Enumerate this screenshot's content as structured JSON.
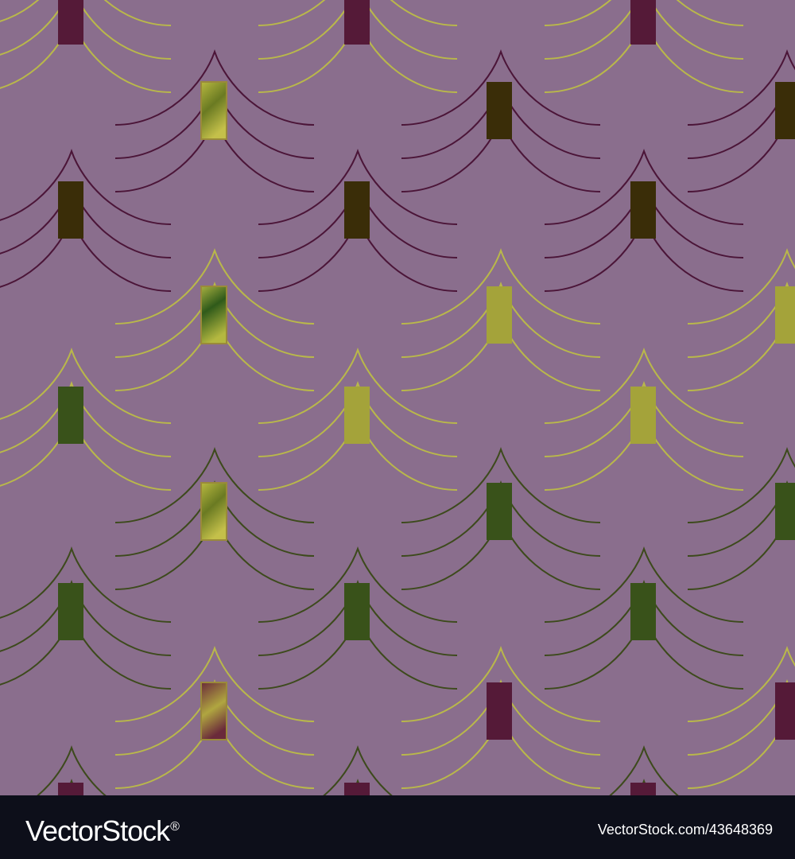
{
  "colors": {
    "background": "#8a6e8d",
    "footer": "#0d0f1a",
    "line_yellow": "#b9b84a",
    "line_purple": "#4b1538",
    "line_olive": "#3d4a1c",
    "rect_maroon": "#551a38",
    "rect_brown": "#3a2d08",
    "rect_green": "#39521a",
    "rect_yellow": "#a4a33a",
    "footer_text": "#ffffff"
  },
  "footer": {
    "logo_text": "VectorStock",
    "logo_mark": "®",
    "image_id": "VectorStock.com/43648369"
  }
}
